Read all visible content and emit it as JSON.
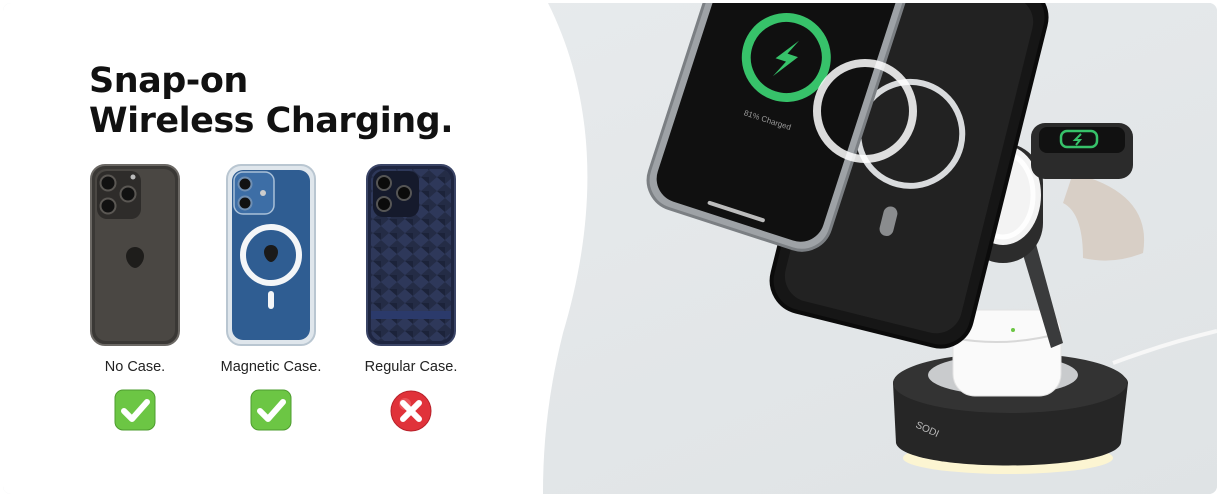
{
  "headline": {
    "line1": "Snap-on",
    "line2": "Wireless Charging."
  },
  "cases": [
    {
      "label": "No Case.",
      "supported": true
    },
    {
      "label": "Magnetic Case.",
      "supported": true
    },
    {
      "label": "Regular Case.",
      "supported": false
    }
  ],
  "product": {
    "screen_text": "81% Charged",
    "brand": "SODI"
  },
  "colors": {
    "check_green": "#6cc644",
    "cross_red": "#e0323a",
    "charge_ring": "#37c26a"
  }
}
